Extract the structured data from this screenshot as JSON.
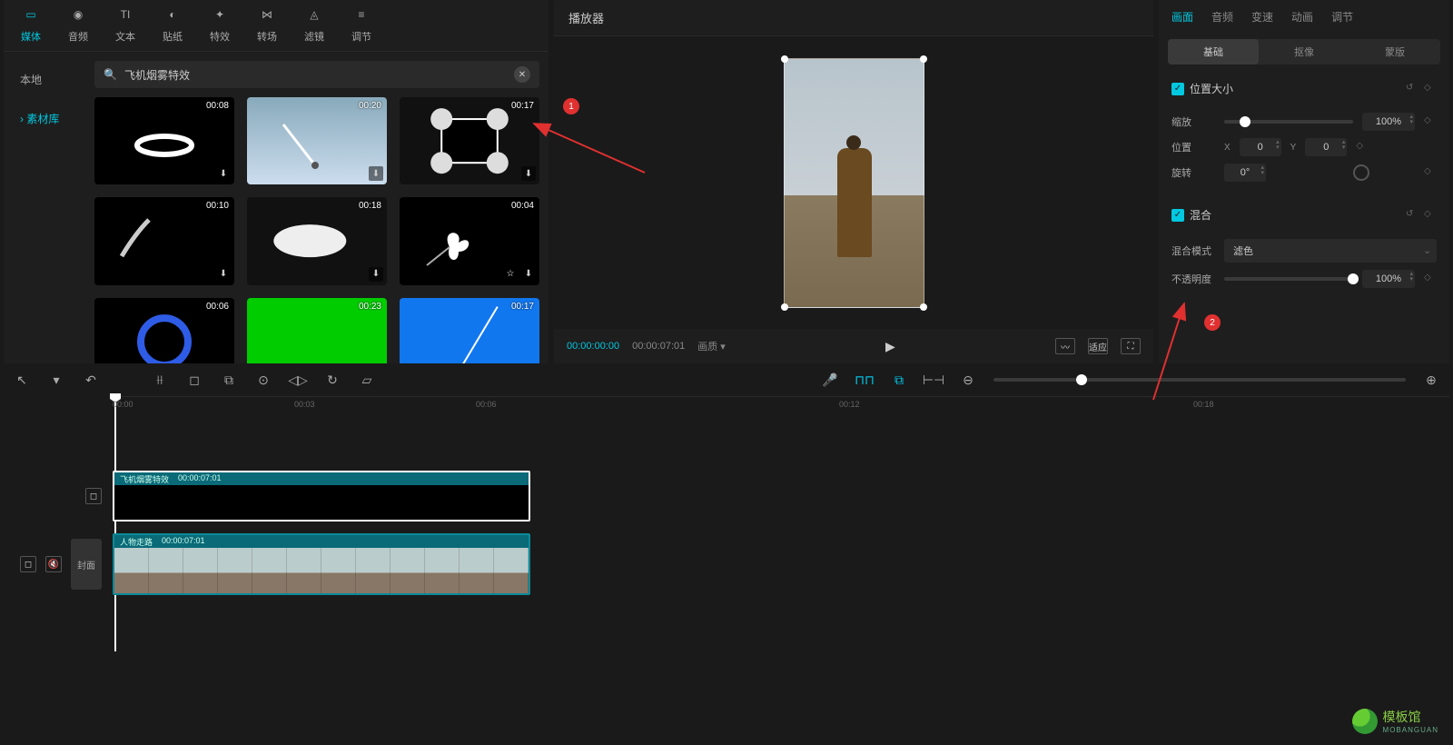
{
  "categories": [
    {
      "label": "媒体",
      "icon": "▭"
    },
    {
      "label": "音频",
      "icon": "◉"
    },
    {
      "label": "文本",
      "icon": "TI"
    },
    {
      "label": "贴纸",
      "icon": "◐"
    },
    {
      "label": "特效",
      "icon": "✦"
    },
    {
      "label": "转场",
      "icon": "⋈"
    },
    {
      "label": "滤镜",
      "icon": "◬"
    },
    {
      "label": "调节",
      "icon": "≡"
    }
  ],
  "lib_tabs": [
    {
      "label": "本地"
    },
    {
      "label": "素材库"
    }
  ],
  "search": {
    "placeholder": "",
    "value": "飞机烟雾特效"
  },
  "clips": [
    {
      "dur": "00:08",
      "bg": "#000"
    },
    {
      "dur": "00:20",
      "bg": "#7aa"
    },
    {
      "dur": "00:17",
      "bg": "#111"
    },
    {
      "dur": "00:10",
      "bg": "#000"
    },
    {
      "dur": "00:18",
      "bg": "#111"
    },
    {
      "dur": "00:04",
      "bg": "#000"
    },
    {
      "dur": "00:06",
      "bg": "#000"
    },
    {
      "dur": "00:23",
      "bg": "#0c0"
    },
    {
      "dur": "00:17",
      "bg": "#17e"
    }
  ],
  "player": {
    "title": "播放器",
    "time_cur": "00:00:00:00",
    "time_total": "00:00:07:01",
    "quality": "画质"
  },
  "prop_tabs": [
    "画面",
    "音频",
    "变速",
    "动画",
    "调节"
  ],
  "sub_tabs": [
    "基础",
    "抠像",
    "蒙版"
  ],
  "sections": {
    "pos": {
      "title": "位置大小",
      "scale_lbl": "缩放",
      "scale_val": "100%",
      "pos_lbl": "位置",
      "x": "0",
      "y": "0",
      "rot_lbl": "旋转",
      "rot_val": "0°"
    },
    "blend": {
      "title": "混合",
      "mode_lbl": "混合模式",
      "mode_val": "滤色",
      "op_lbl": "不透明度",
      "op_val": "100%"
    }
  },
  "ruler": [
    "00:00",
    "00:03",
    "00:06",
    "…",
    "00:12",
    "…",
    "00:18",
    "…"
  ],
  "track1": {
    "name": "飞机烟雾特效",
    "dur": "00:00:07:01"
  },
  "track2": {
    "name": "人物走路",
    "dur": "00:00:07:01",
    "cover": "封面"
  },
  "markers": {
    "m1": "1",
    "m2": "2"
  },
  "watermark": {
    "name": "模板馆",
    "sub": "MOBANGUAN"
  }
}
